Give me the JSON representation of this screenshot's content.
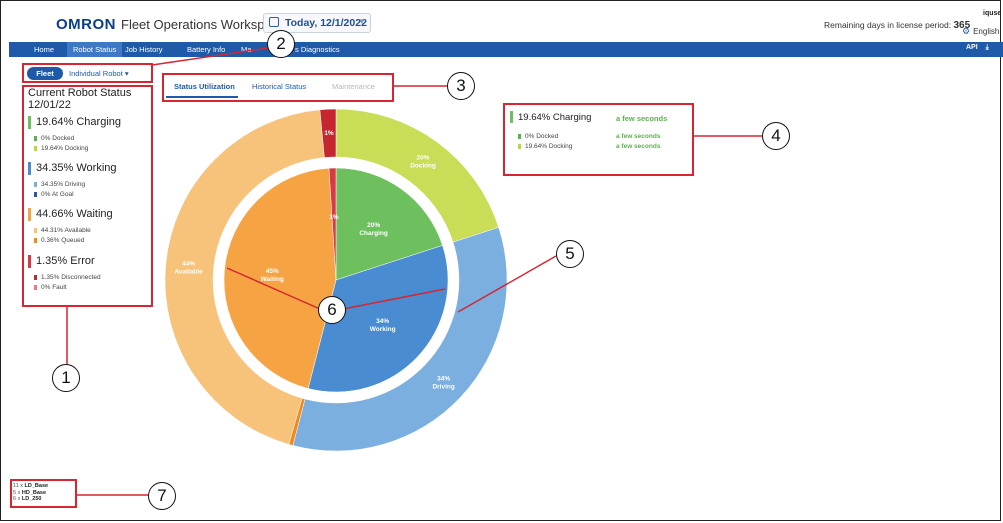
{
  "header": {
    "logo": "OMRON",
    "app_title": "Fleet Operations Workspace iQ",
    "date_button": "Today, 12/1/2022",
    "license_label": "Remaining days in license period:",
    "license_days": "365",
    "user": "iquse",
    "language": "English"
  },
  "nav": {
    "items": [
      "Home",
      "Robot Status",
      "Job History",
      "Battery Info",
      "Ma",
      "s Diagnostics"
    ],
    "active": "Robot Status",
    "right_icons": [
      "API",
      "download"
    ]
  },
  "toggle": {
    "fleet": "Fleet",
    "individual": "Individual Robot"
  },
  "status": {
    "title": "Current Robot Status",
    "date": "12/01/22",
    "groups": [
      {
        "label": "19.64%  Charging",
        "color": "#6ebf5e",
        "items": [
          {
            "label": "0%  Docked",
            "color": "#5bb24a"
          },
          {
            "label": "19.64%  Docking",
            "color": "#b8d64a"
          }
        ]
      },
      {
        "label": "34.35%  Working",
        "color": "#4a8cd1",
        "items": [
          {
            "label": "34.35%  Driving",
            "color": "#7aafe0"
          },
          {
            "label": "0%  At Goal",
            "color": "#2a5aa8"
          }
        ]
      },
      {
        "label": "44.66%  Waiting",
        "color": "#f6a443",
        "items": [
          {
            "label": "44.31%  Available",
            "color": "#f7c27a"
          },
          {
            "label": "0.36%  Queued",
            "color": "#f08a1e"
          }
        ]
      },
      {
        "label": "1.35%  Error",
        "color": "#d63a45",
        "items": [
          {
            "label": "1.35%  Disconnected",
            "color": "#c5262f"
          },
          {
            "label": "0%  Fault",
            "color": "#e87a80"
          }
        ]
      }
    ]
  },
  "tabs": [
    "Status Utilization",
    "Historical Status",
    "Maintenance"
  ],
  "info_panel": {
    "head": "19.64%  Charging",
    "head_time": "a few seconds",
    "rows": [
      {
        "label": "0%  Docked",
        "time": "a few seconds",
        "color": "#5bb24a"
      },
      {
        "label": "19.64%  Docking",
        "time": "a few seconds",
        "color": "#b8d64a"
      }
    ]
  },
  "chart_data": {
    "type": "pie",
    "inner": [
      {
        "name": "Charging",
        "value": 20,
        "label": "20%\nCharging",
        "color": "#6ebf5e"
      },
      {
        "name": "Working",
        "value": 34,
        "label": "34%\nWorking",
        "color": "#4a8cd1"
      },
      {
        "name": "Waiting",
        "value": 45,
        "label": "45%\nWaiting",
        "color": "#f6a443"
      },
      {
        "name": "Error",
        "value": 1,
        "label": "1%",
        "color": "#d63a45"
      }
    ],
    "outer": [
      {
        "name": "Docking",
        "value": 20,
        "label": "20%\nDocking",
        "color": "#c9dd57"
      },
      {
        "name": "Driving",
        "value": 34,
        "label": "34%\nDriving",
        "color": "#7aafe0"
      },
      {
        "name": "Queued",
        "value": 0.4,
        "label": "",
        "color": "#f08a1e"
      },
      {
        "name": "Available",
        "value": 44,
        "label": "44%\nAvailable",
        "color": "#f7c27a"
      },
      {
        "name": "Disconnected",
        "value": 1.5,
        "label": "1%",
        "color": "#c5262f"
      }
    ]
  },
  "fleet_list": [
    {
      "count": "11 x",
      "model": "LD_Base"
    },
    {
      "count": "5 x",
      "model": "HD_Base"
    },
    {
      "count": "6 x",
      "model": "LD_250"
    }
  ],
  "callouts": [
    "1",
    "2",
    "3",
    "4",
    "5",
    "6",
    "7"
  ]
}
